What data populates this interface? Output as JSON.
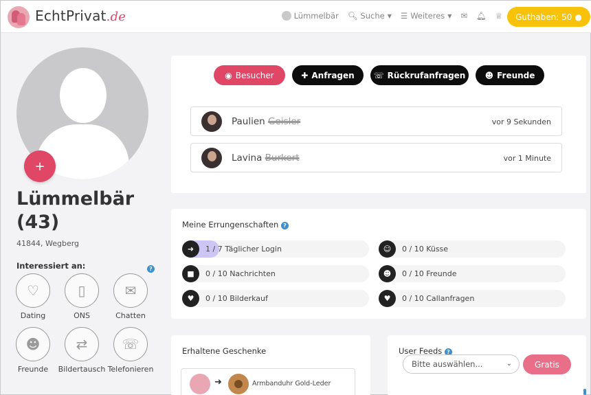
{
  "nav": {
    "logo_text": "EchtPrivat",
    "logo_suffix": ".de",
    "user_label": "Lümmelbär",
    "search_label": "Suche",
    "more_label": "Weiteres",
    "credit_label": "Guthaben: 50"
  },
  "profile": {
    "add_label": "+",
    "name": "Lümmelbär",
    "age": "(43)",
    "location": "41844, Wegberg",
    "interest_title": "Interessiert an:",
    "interests": [
      {
        "label": "Dating",
        "icon": "heart-pulse-icon"
      },
      {
        "label": "ONS",
        "icon": "condom-icon"
      },
      {
        "label": "Chatten",
        "icon": "chat-bubble-icon"
      },
      {
        "label": "Freunde",
        "icon": "group-icon"
      },
      {
        "label": "Bildertausch",
        "icon": "photo-exchange-icon"
      },
      {
        "label": "Telefonieren",
        "icon": "phone-icon"
      }
    ]
  },
  "visitor_card": {
    "tabs": [
      {
        "label": "Besucher",
        "icon": "eye-icon"
      },
      {
        "label": "Anfragen",
        "icon": "user-plus-icon"
      },
      {
        "label": "Rückrufanfragen",
        "icon": "phone-icon"
      },
      {
        "label": "Freunde",
        "icon": "users-icon"
      }
    ],
    "visitors": [
      {
        "first_name": "Paulien",
        "last_name": "Geisler",
        "time": "vor 9 Sekunden"
      },
      {
        "first_name": "Lavina",
        "last_name": "Burkert",
        "time": "vor 1 Minute"
      }
    ]
  },
  "achievements": {
    "title": "Meine Errungenschaften",
    "items": [
      {
        "text": "1 / 7 Täglicher Login",
        "icon": "arrow-right-icon",
        "progress": 0.14
      },
      {
        "text": "0 / 10 Küsse",
        "icon": "kiss-icon",
        "progress": 0
      },
      {
        "text": "0 / 10 Nachrichten",
        "icon": "message-icon",
        "progress": 0
      },
      {
        "text": "0 / 10 Freunde",
        "icon": "users-icon",
        "progress": 0
      },
      {
        "text": "0 / 10 Bilderkauf",
        "icon": "heart-icon",
        "progress": 0
      },
      {
        "text": "0 / 10 Callanfragen",
        "icon": "heart-icon",
        "progress": 0
      }
    ]
  },
  "gifts": {
    "title": "Erhaltene Geschenke",
    "item_label": "Armbanduhr Gold-Leder"
  },
  "feeds": {
    "title": "User Feeds",
    "select_placeholder": "Bitte auswählen...",
    "gratis_label": "Gratis"
  },
  "colors": {
    "accent_red": "#e04767",
    "credit_yellow": "#f9c20a",
    "progress_purple": "#cdc6f5",
    "info_blue": "#3c8fd0"
  }
}
